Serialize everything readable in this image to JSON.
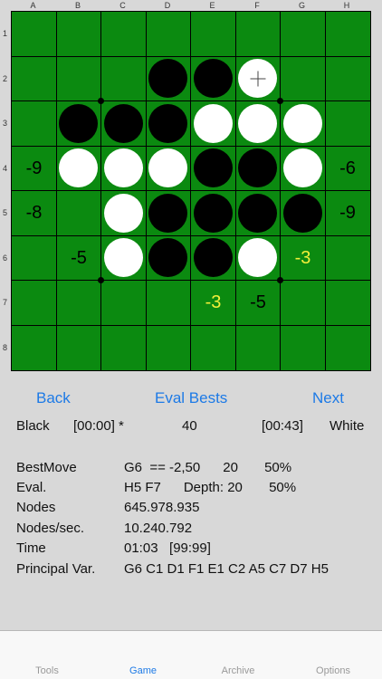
{
  "board": {
    "columns": [
      "A",
      "B",
      "C",
      "D",
      "E",
      "F",
      "G",
      "H"
    ],
    "rows": [
      "1",
      "2",
      "3",
      "4",
      "5",
      "6",
      "7",
      "8"
    ],
    "cells": [
      [
        "",
        "",
        "",
        "",
        "",
        "",
        "",
        ""
      ],
      [
        "",
        "",
        "",
        "B",
        "B",
        "W",
        "",
        ""
      ],
      [
        "",
        "B",
        "B",
        "B",
        "W",
        "W",
        "W",
        ""
      ],
      [
        "",
        "W",
        "W",
        "W",
        "B",
        "B",
        "W",
        ""
      ],
      [
        "",
        "",
        "W",
        "B",
        "B",
        "B",
        "B",
        ""
      ],
      [
        "",
        "",
        "W",
        "B",
        "B",
        "W",
        "",
        ""
      ],
      [
        "",
        "",
        "",
        "",
        "",
        "",
        "",
        ""
      ],
      [
        "",
        "",
        "",
        "",
        "",
        "",
        "",
        ""
      ]
    ],
    "last_move_marker": {
      "row": 1,
      "col": 5,
      "icon": "plus-cross-icon"
    },
    "evaluations": [
      {
        "row": 3,
        "col": 0,
        "text": "-9",
        "best": false
      },
      {
        "row": 3,
        "col": 7,
        "text": "-6",
        "best": false
      },
      {
        "row": 4,
        "col": 0,
        "text": "-8",
        "best": false
      },
      {
        "row": 4,
        "col": 7,
        "text": "-9",
        "best": false
      },
      {
        "row": 5,
        "col": 1,
        "text": "-5",
        "best": false
      },
      {
        "row": 5,
        "col": 6,
        "text": "-3",
        "best": true
      },
      {
        "row": 6,
        "col": 4,
        "text": "-3",
        "best": true
      },
      {
        "row": 6,
        "col": 5,
        "text": "-5",
        "best": false
      }
    ],
    "colors": {
      "board": "#0b8a10",
      "best_eval": "#f2ef3a"
    }
  },
  "nav": {
    "back": "Back",
    "eval_bests": "Eval Bests",
    "next": "Next"
  },
  "status": {
    "black_label": "Black",
    "black_time": "[00:00] *",
    "move_number": "40",
    "white_time": "[00:43]",
    "white_label": "White"
  },
  "info": [
    {
      "label": "BestMove",
      "value": "G6  == -2,50      20       50%"
    },
    {
      "label": "Eval.",
      "value": "H5 F7      Depth: 20       50%"
    },
    {
      "label": "Nodes",
      "value": "645.978.935"
    },
    {
      "label": "Nodes/sec.",
      "value": "10.240.792"
    },
    {
      "label": "Time",
      "value": "01:03   [99:99]"
    },
    {
      "label": "Principal Var.",
      "value": "G6 C1 D1 F1 E1 C2 A5 C7 D7 H5"
    }
  ],
  "tabs": [
    {
      "label": "Tools",
      "active": false
    },
    {
      "label": "Game",
      "active": true
    },
    {
      "label": "Archive",
      "active": false
    },
    {
      "label": "Options",
      "active": false
    }
  ]
}
